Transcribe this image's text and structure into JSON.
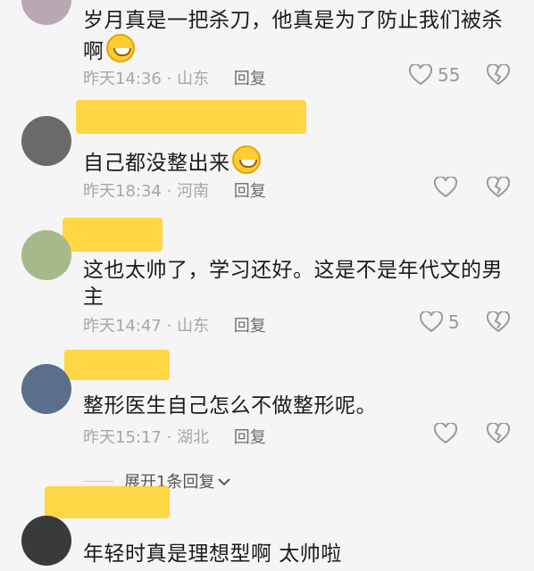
{
  "comments": [
    {
      "text": "岁月真是一把杀刀，他真是为了防止我们被杀啊",
      "time": "昨天14:36",
      "location": "山东",
      "reply": "回复",
      "likes": "55",
      "has_emoji": true
    },
    {
      "text": "自己都没整出来",
      "time": "昨天18:34",
      "location": "河南",
      "reply": "回复",
      "likes": "",
      "has_emoji": true
    },
    {
      "text": "这也太帅了，学习还好。这是不是年代文的男主",
      "time": "昨天14:47",
      "location": "山东",
      "reply": "回复",
      "likes": "5",
      "has_emoji": false
    },
    {
      "text": "整形医生自己怎么不做整形呢。",
      "time": "昨天15:17",
      "location": "湖北",
      "reply": "回复",
      "likes": "",
      "has_emoji": false
    },
    {
      "text": "年轻时真是理想型啊 太帅啦",
      "time": "",
      "location": "",
      "reply": "",
      "likes": "",
      "has_emoji": false
    }
  ],
  "expand_replies": "展开1条回复",
  "icons": {
    "like": "heart-outline-icon",
    "dislike": "broken-heart-icon",
    "expand": "chevron-down-icon"
  },
  "colors": {
    "background": "#f5f5f5",
    "name_mask": "#ffd43a",
    "meta": "#a7a7a7"
  }
}
